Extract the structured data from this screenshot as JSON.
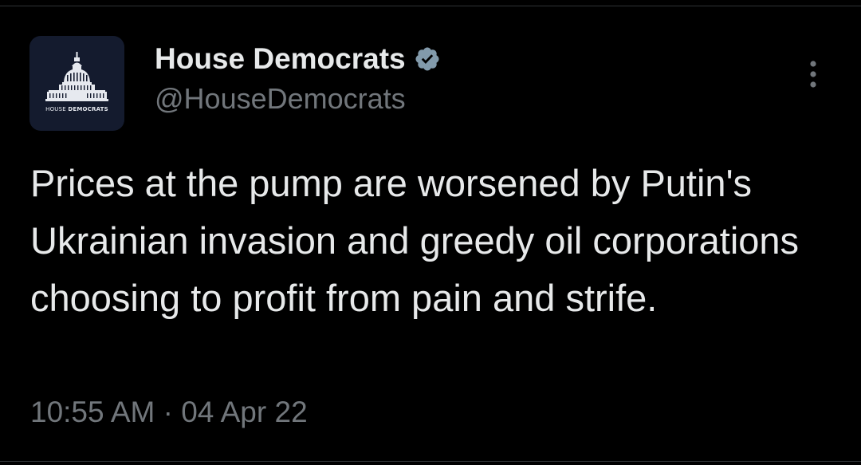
{
  "tweet": {
    "author": {
      "display_name": "House Democrats",
      "handle": "@HouseDemocrats",
      "verified_icon": "verified-badge-icon",
      "avatar": {
        "caption_light": "HOUSE ",
        "caption_bold": "DEMOCRATS",
        "icon": "capitol-dome-icon",
        "background_color": "#141b2e"
      }
    },
    "text": "Prices at the pump are worsened by Putin's Ukrainian invasion and greedy oil corporations choosing to profit from pain and strife.",
    "time": "10:55 AM",
    "separator": "·",
    "date": "04 Apr 22",
    "more_icon": "more-vertical-icon"
  },
  "colors": {
    "background": "#000000",
    "text_primary": "#e7e9ea",
    "text_secondary": "#71767b",
    "verified_badge": "#829aab",
    "divider": "#2f3336"
  }
}
